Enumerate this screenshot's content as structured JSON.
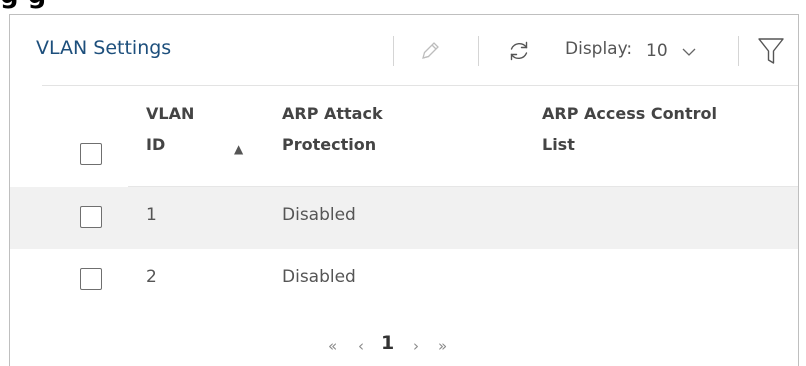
{
  "caption": "g                          g",
  "panel": {
    "title": "VLAN Settings"
  },
  "toolbar": {
    "edit_icon": "pencil-icon",
    "refresh_icon": "refresh-icon",
    "display_label": "Display:",
    "display_value": "10",
    "filter_icon": "filter-icon"
  },
  "table": {
    "columns": [
      {
        "key": "vlan_id",
        "label_line1": "VLAN",
        "label_line2": "ID",
        "sorted": "ascending"
      },
      {
        "key": "arp_attack",
        "label_line1": "ARP Attack",
        "label_line2": "Protection"
      },
      {
        "key": "acl",
        "label_line1": "ARP Access Control",
        "label_line2": "List"
      }
    ],
    "rows": [
      {
        "vlan_id": "1",
        "arp_attack": "Disabled",
        "acl": ""
      },
      {
        "vlan_id": "2",
        "arp_attack": "Disabled",
        "acl": ""
      }
    ]
  },
  "pagination": {
    "first": "«",
    "prev": "‹",
    "current": "1",
    "next": "›",
    "last": "»"
  },
  "colors": {
    "title": "#1d4f7c",
    "row_alt": "#f1f1f1",
    "border": "#bfbfbf"
  }
}
